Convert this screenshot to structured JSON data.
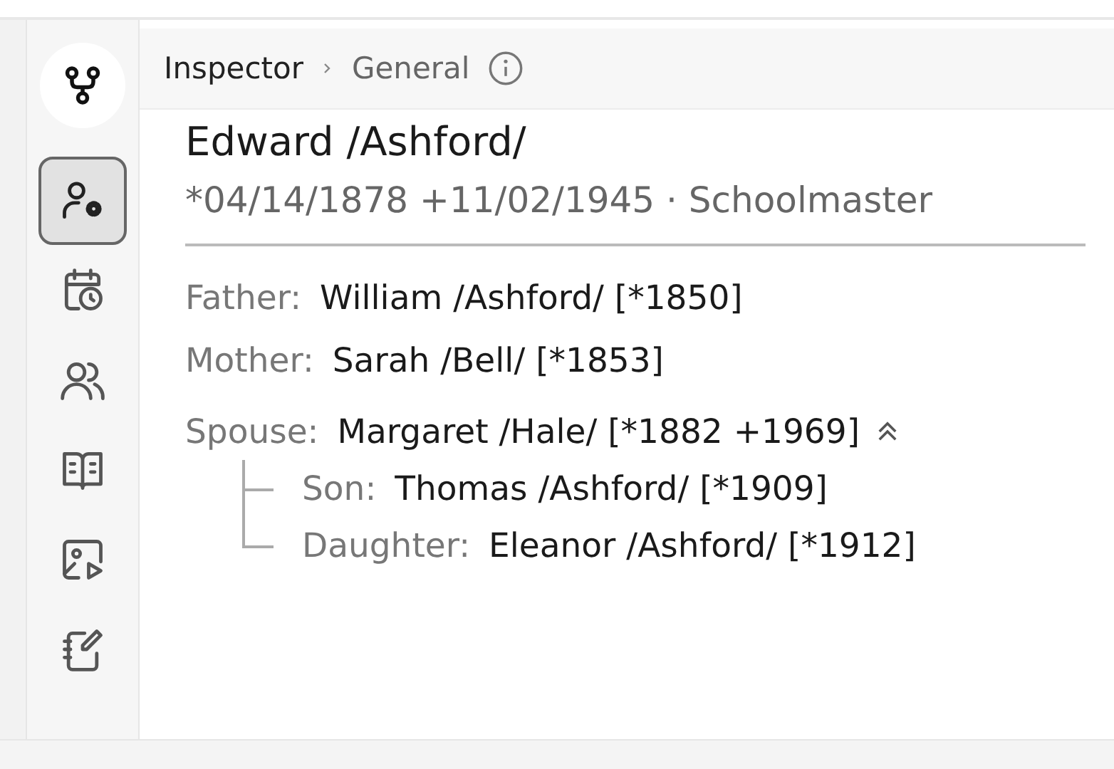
{
  "sidebar": {
    "items": [
      {
        "kind": "profile",
        "selected": true
      },
      {
        "kind": "events",
        "selected": false
      },
      {
        "kind": "people",
        "selected": false
      },
      {
        "kind": "sources",
        "selected": false
      },
      {
        "kind": "media",
        "selected": false
      },
      {
        "kind": "notes",
        "selected": false
      }
    ]
  },
  "breadcrumb": [
    "Inspector",
    "General"
  ],
  "person": {
    "name": "Edward /Ashford/",
    "details": "*04/14/1878 +11/02/1945 · Schoolmaster"
  },
  "relations": [
    {
      "role": "Father:",
      "name": "William /Ashford/ [*1850]"
    },
    {
      "role": "Mother:",
      "name": "Sarah /Bell/ [*1853]"
    }
  ],
  "families": [
    {
      "role": "Spouse:",
      "name": "Margaret /Hale/ [*1882 +1969]",
      "expanded": true,
      "children": [
        {
          "role": "Son:",
          "name": "Thomas /Ashford/ [*1909]"
        },
        {
          "role": "Daughter:",
          "name": "Eleanor /Ashford/ [*1912]"
        }
      ]
    }
  ]
}
